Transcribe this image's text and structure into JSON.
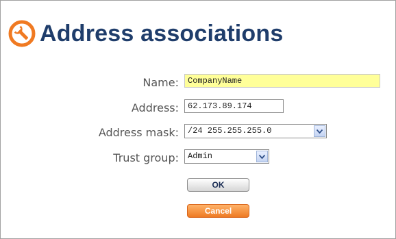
{
  "page": {
    "title": "Address associations",
    "icon": "wrench-icon",
    "accent_color": "#f07a22",
    "title_color": "#1f3d6b"
  },
  "form": {
    "name": {
      "label": "Name:",
      "value": "CompanyName"
    },
    "address": {
      "label": "Address:",
      "value": "62.173.89.174"
    },
    "address_mask": {
      "label": "Address mask:",
      "value": "/24 255.255.255.0"
    },
    "trust_group": {
      "label": "Trust group:",
      "value": "Admin"
    }
  },
  "buttons": {
    "ok_label": "OK",
    "cancel_label": "Cancel"
  }
}
